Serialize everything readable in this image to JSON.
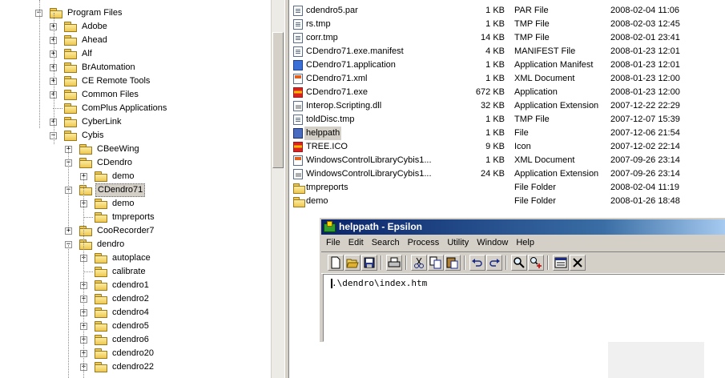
{
  "tree": {
    "items": [
      {
        "label": "Program Files",
        "level": 0,
        "expander": "−"
      },
      {
        "label": "Adobe",
        "level": 1,
        "expander": "+"
      },
      {
        "label": "Ahead",
        "level": 1,
        "expander": "+"
      },
      {
        "label": "Alf",
        "level": 1,
        "expander": "+"
      },
      {
        "label": "BrAutomation",
        "level": 1,
        "expander": "+"
      },
      {
        "label": "CE Remote Tools",
        "level": 1,
        "expander": "+"
      },
      {
        "label": "Common Files",
        "level": 1,
        "expander": "+"
      },
      {
        "label": "ComPlus Applications",
        "level": 1,
        "expander": ""
      },
      {
        "label": "CyberLink",
        "level": 1,
        "expander": "+"
      },
      {
        "label": "Cybis",
        "level": 1,
        "expander": "−"
      },
      {
        "label": "CBeeWing",
        "level": 2,
        "expander": "+"
      },
      {
        "label": "CDendro",
        "level": 2,
        "expander": "−"
      },
      {
        "label": "demo",
        "level": 3,
        "expander": "+"
      },
      {
        "label": "CDendro71",
        "level": 2,
        "expander": "−",
        "selected": true
      },
      {
        "label": "demo",
        "level": 3,
        "expander": "+"
      },
      {
        "label": "tmpreports",
        "level": 3,
        "expander": ""
      },
      {
        "label": "CooRecorder7",
        "level": 2,
        "expander": "+"
      },
      {
        "label": "dendro",
        "level": 2,
        "expander": "−"
      },
      {
        "label": "autoplace",
        "level": 3,
        "expander": "+"
      },
      {
        "label": "calibrate",
        "level": 3,
        "expander": ""
      },
      {
        "label": "cdendro1",
        "level": 3,
        "expander": "+"
      },
      {
        "label": "cdendro2",
        "level": 3,
        "expander": "+"
      },
      {
        "label": "cdendro4",
        "level": 3,
        "expander": "+"
      },
      {
        "label": "cdendro5",
        "level": 3,
        "expander": "+"
      },
      {
        "label": "cdendro6",
        "level": 3,
        "expander": "+"
      },
      {
        "label": "cdendro20",
        "level": 3,
        "expander": "+"
      },
      {
        "label": "cdendro22",
        "level": 3,
        "expander": "+"
      }
    ]
  },
  "files": {
    "rows": [
      {
        "name": "cdendro5.par",
        "size": "1 KB",
        "type": "PAR File",
        "date": "2008-02-04 11:06",
        "icon": "document-icon"
      },
      {
        "name": "rs.tmp",
        "size": "1 KB",
        "type": "TMP File",
        "date": "2008-02-03 12:45",
        "icon": "document-icon"
      },
      {
        "name": "corr.tmp",
        "size": "14 KB",
        "type": "TMP File",
        "date": "2008-02-01 23:41",
        "icon": "document-icon"
      },
      {
        "name": "CDendro71.exe.manifest",
        "size": "4 KB",
        "type": "MANIFEST File",
        "date": "2008-01-23 12:01",
        "icon": "document-icon"
      },
      {
        "name": "CDendro71.application",
        "size": "1 KB",
        "type": "Application Manifest",
        "date": "2008-01-23 12:01",
        "icon": "application-manifest-icon"
      },
      {
        "name": "CDendro71.xml",
        "size": "1 KB",
        "type": "XML Document",
        "date": "2008-01-23 12:00",
        "icon": "xml-icon"
      },
      {
        "name": "CDendro71.exe",
        "size": "672 KB",
        "type": "Application",
        "date": "2008-01-23 12:00",
        "icon": "exe-icon"
      },
      {
        "name": "Interop.Scripting.dll",
        "size": "32 KB",
        "type": "Application Extension",
        "date": "2007-12-22 22:29",
        "icon": "dll-icon"
      },
      {
        "name": "toldDisc.tmp",
        "size": "1 KB",
        "type": "TMP File",
        "date": "2007-12-07 15:39",
        "icon": "document-icon"
      },
      {
        "name": "helppath",
        "size": "1 KB",
        "type": "File",
        "date": "2007-12-06 21:54",
        "icon": "file-icon",
        "selected": true
      },
      {
        "name": "TREE.ICO",
        "size": "9 KB",
        "type": "Icon",
        "date": "2007-12-02 22:14",
        "icon": "exe-icon"
      },
      {
        "name": "WindowsControlLibraryCybis1...",
        "size": "1 KB",
        "type": "XML Document",
        "date": "2007-09-26 23:14",
        "icon": "xml-icon"
      },
      {
        "name": "WindowsControlLibraryCybis1...",
        "size": "24 KB",
        "type": "Application Extension",
        "date": "2007-09-26 23:14",
        "icon": "dll-icon"
      },
      {
        "name": "tmpreports",
        "size": "",
        "type": "File Folder",
        "date": "2008-02-04 11:19",
        "icon": "folder-icon"
      },
      {
        "name": "demo",
        "size": "",
        "type": "File Folder",
        "date": "2008-01-26 18:48",
        "icon": "folder-icon"
      }
    ]
  },
  "editor": {
    "title": "helppath - Epsilon",
    "menus": [
      "File",
      "Edit",
      "Search",
      "Process",
      "Utility",
      "Window",
      "Help"
    ],
    "toolbar": [
      "new-file-icon",
      "open-folder-icon",
      "save-icon",
      "print-icon",
      "cut-icon",
      "copy-icon",
      "paste-icon",
      "undo-icon",
      "redo-icon",
      "find-icon",
      "replace-icon",
      "window-list-icon",
      "close-icon"
    ],
    "content": ".\\dendro\\index.htm"
  }
}
